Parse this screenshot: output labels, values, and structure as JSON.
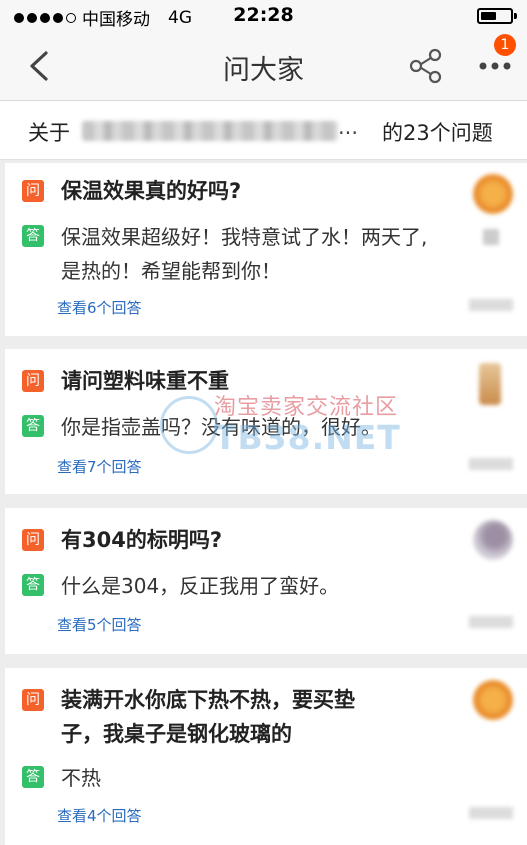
{
  "status_bar": {
    "carrier": "中国移动",
    "network": "4G",
    "time": "22:28",
    "battery_level": 0.55
  },
  "nav": {
    "title": "问大家",
    "badge_count": "1",
    "icons": [
      "chevron-left-icon",
      "share-icon",
      "more-icon"
    ]
  },
  "about": {
    "prefix": "关于",
    "ellipsis": "...",
    "suffix": "的23个问题"
  },
  "questions": [
    {
      "q_tag": "问",
      "question": "保温效果真的好吗?",
      "a_tag": "答",
      "answer_lines": [
        "保温效果超级好！我特意试了水！两天了,",
        "是热的！希望能帮到你！"
      ],
      "link": "查看6个回答"
    },
    {
      "q_tag": "问",
      "question": "请问塑料味重不重",
      "a_tag": "答",
      "answer_lines": [
        "你是指壶盖吗？没有味道的，很好。"
      ],
      "link": "查看7个回答"
    },
    {
      "q_tag": "问",
      "question": "有304的标明吗?",
      "a_tag": "答",
      "answer_lines": [
        "什么是304，反正我用了蛮好。"
      ],
      "link": "查看5个回答"
    },
    {
      "q_tag": "问",
      "question_lines": [
        "装满开水你底下热不热，要买垫",
        "子，我桌子是钢化玻璃的"
      ],
      "a_tag": "答",
      "answer_lines": [
        "不热"
      ],
      "link": "查看4个回答"
    }
  ],
  "watermark": {
    "line1": "淘宝卖家交流社区",
    "line2": "TB38.NET"
  },
  "colors": {
    "question_tag": "#f5612b",
    "answer_tag": "#34c06a",
    "link": "#2a6bbf",
    "badge": "#ff5000"
  }
}
